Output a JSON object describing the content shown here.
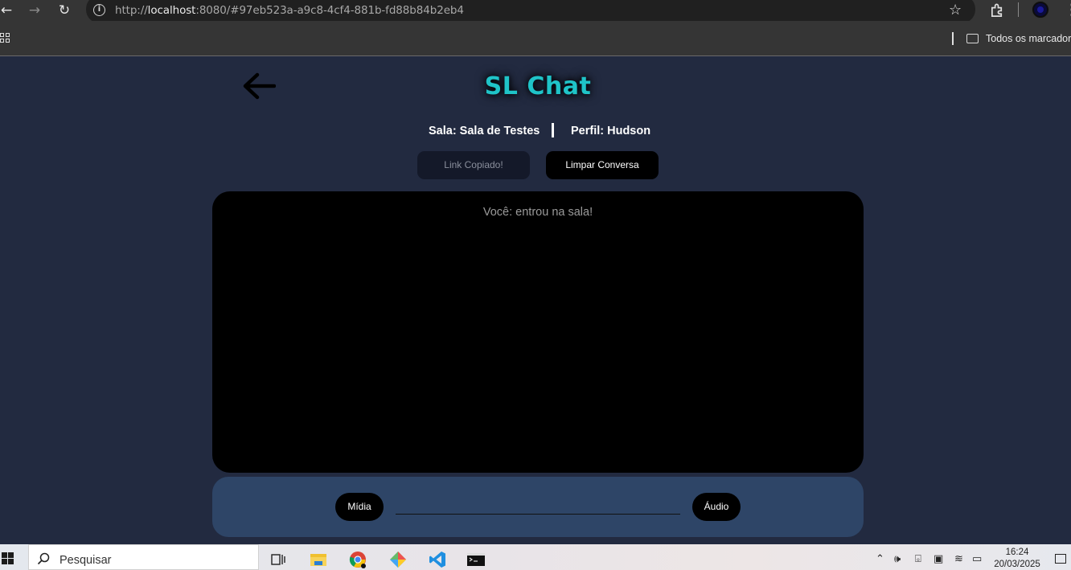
{
  "browser": {
    "url_prefix": "http://",
    "url_host": "localhost",
    "url_rest": ":8080/#97eb523a-a9c8-4cf4-881b-fd88b84b2eb4",
    "bookmarks_label": "Todos os marcadores"
  },
  "app": {
    "title": "SL Chat",
    "room_label": "Sala: Sala de Testes",
    "profile_label": "Perfil: Hudson",
    "copy_link_button": "Link Copiado!",
    "clear_button": "Limpar Conversa",
    "messages": [
      "Você: entrou na sala!"
    ],
    "media_button": "Mídia",
    "audio_button": "Áudio",
    "message_input_value": "",
    "title_color": "#1fc4c8",
    "background_color": "#222a40",
    "chat_background": "#000000",
    "input_bar_color": "#2e4567"
  },
  "taskbar": {
    "search_placeholder": "Pesquisar",
    "time": "16:24",
    "date": "20/03/2025"
  }
}
